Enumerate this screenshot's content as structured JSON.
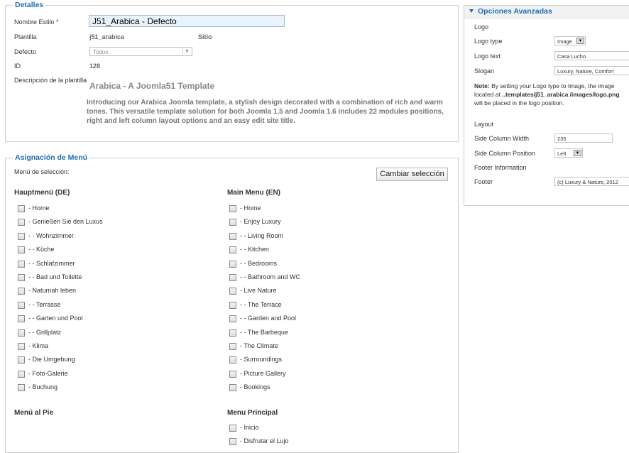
{
  "details": {
    "legend": "Detalles",
    "style_name_label": "Nombre Estilo",
    "required_mark": "*",
    "style_name_value": "J51_Arabica - Defecto",
    "template_label": "Plantilla",
    "template_value": "j51_arabica",
    "site_value": "Sitio",
    "default_label": "Defecto",
    "default_value": "Todos",
    "id_label": "ID",
    "id_value": "128",
    "desc_label": "Descripción de la plantilla",
    "desc_title": "Arabica - A Joomla51 Template",
    "desc_text": "Introducing our Arabica Joomla template, a stylish design decorated with a combination of rich and warm tones. This versatile template solution for both Joomla 1.5 and Joomla 1.6 includes 22 modules positions, right and left column layout options and an easy edit site title."
  },
  "menu_assign": {
    "legend": "Asignación de Menú",
    "selection_label": "Menú de selección:",
    "change_button": "Cambiar selección",
    "col1_title": "Hauptmenü (DE)",
    "col1_items": [
      "- Home",
      "- Genießen Sie den Luxus",
      "- - Wohnzimmer",
      "- - Küche",
      "- - Schlafzimmer",
      "- - Bad und Toilette",
      "- Naturnah leben",
      "- - Terrasse",
      "- - Garten und Pool",
      "- - Grillplatz",
      "- Klima",
      "- Die Umgebung",
      "- Foto-Galerie",
      "- Buchung"
    ],
    "col2_title": "Main Menu (EN)",
    "col2_items": [
      "- Home",
      "- Enjoy Luxury",
      "- - Living Room",
      "- - Kitchen",
      "- - Bedrooms",
      "- - Bathroom and WC",
      "- Live Nature",
      "- - The Terrace",
      "- - Garden and Pool",
      "- - The Barbeque",
      "- The Climate",
      "- Surroundings",
      "- Picture Gallery",
      "- Bookings"
    ],
    "col3_title": "Menú al Pie",
    "col4_title": "Menu Principal",
    "col4_items": [
      "- Inicio",
      "- Disfrutar el Lujo"
    ]
  },
  "advanced": {
    "title": "Opciones Avanzadas",
    "logo_heading": "Logo",
    "logo_type_label": "Logo type",
    "logo_type_value": "Image",
    "logo_text_label": "Logo text",
    "logo_text_value": "Casa Lucho",
    "slogan_label": "Slogan",
    "slogan_value": "Luxury, Nature, Comfort",
    "note_bold": "Note:",
    "note_text1": " By setting your Logo type to Image, the image located at ",
    "note_path": "..templates/j51_arabica /images/logo.png",
    "note_text2": " will be placed in the logo position.",
    "layout_heading": "Layout",
    "side_width_label": "Side Column Width",
    "side_width_value": "235",
    "side_pos_label": "Side Column Position",
    "side_pos_value": "Left",
    "footer_info_heading": "Footer Information",
    "footer_label": "Footer",
    "footer_value": "(c) Luxury & Nature, 2012"
  }
}
